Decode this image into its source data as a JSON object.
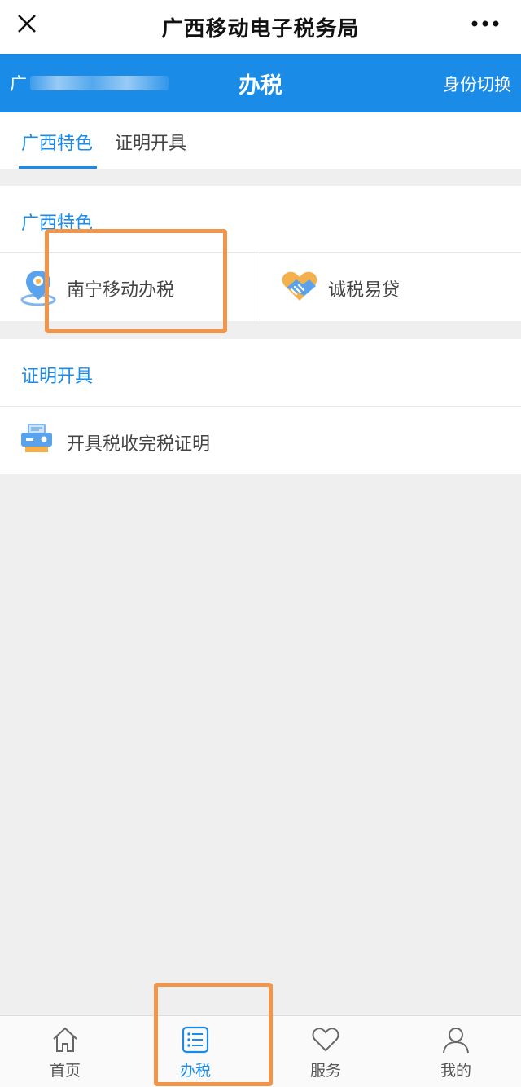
{
  "wechat_bar": {
    "title": "广西移动电子税务局",
    "close_icon": "close-icon",
    "more_icon": "more-dots-icon"
  },
  "header": {
    "user_name_partial": "广",
    "title": "办税",
    "switch_identity": "身份切换",
    "color": "#1b8be8"
  },
  "tabs": [
    {
      "label": "广西特色",
      "active": true
    },
    {
      "label": "证明开具",
      "active": false
    }
  ],
  "sections": {
    "guangxi": {
      "title": "广西特色",
      "items": [
        {
          "label": "南宁移动办税",
          "icon": "location-pin-icon"
        },
        {
          "label": "诚税易贷",
          "icon": "handshake-icon"
        }
      ]
    },
    "certificate": {
      "title": "证明开具",
      "items": [
        {
          "label": "开具税收完税证明",
          "icon": "printer-icon"
        }
      ]
    }
  },
  "bottom_nav": [
    {
      "label": "首页",
      "icon": "home-icon",
      "active": false
    },
    {
      "label": "办税",
      "icon": "list-icon",
      "active": true
    },
    {
      "label": "服务",
      "icon": "heart-icon",
      "active": false
    },
    {
      "label": "我的",
      "icon": "user-icon",
      "active": false
    }
  ],
  "highlight_color": "#f0954a"
}
